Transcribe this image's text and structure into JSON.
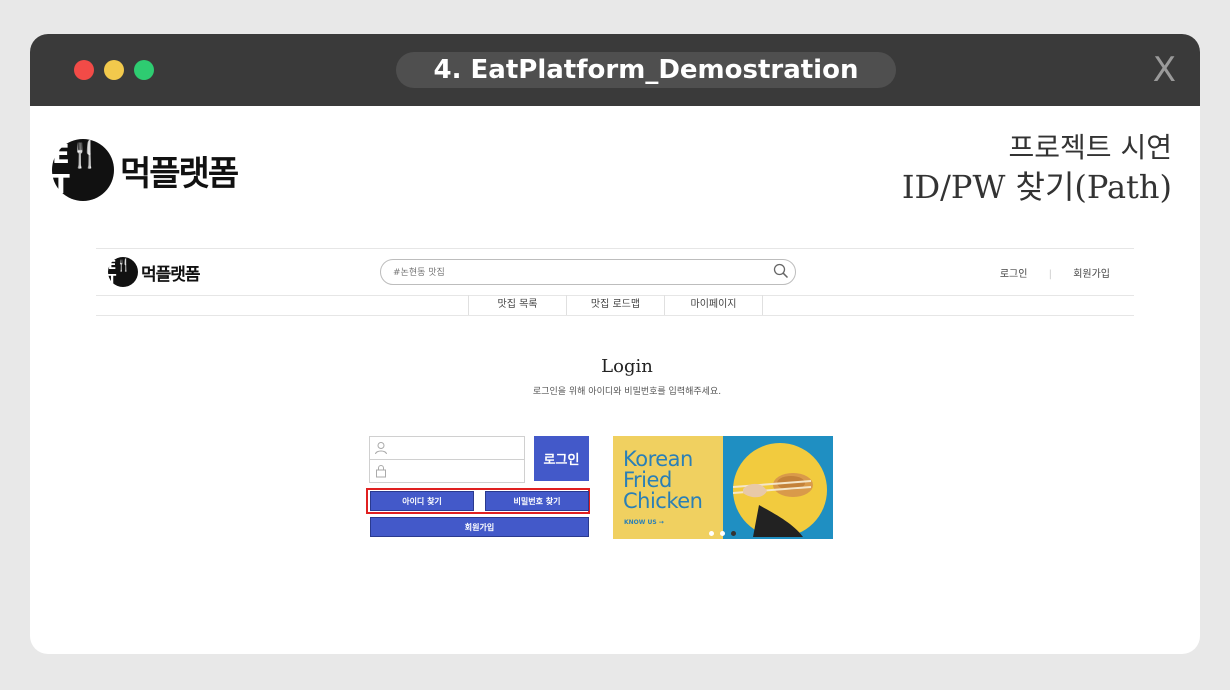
{
  "window": {
    "title": "4. EatPlatform_Demostration",
    "close_label": "X",
    "traffic_lights": [
      "#f24b47",
      "#f2c94c",
      "#2ecc71"
    ]
  },
  "slide": {
    "logo_badge": "E🍴T",
    "logo_text": "먹플랫폼",
    "subtitle": "프로젝트 시연",
    "title": "ID/PW 찾기(Path)"
  },
  "site": {
    "logo_badge": "E🍴T",
    "logo_text": "먹플랫폼",
    "search_placeholder": "#논현동 맛집",
    "top_links": [
      "로그인",
      "회원가입"
    ],
    "menu": [
      "맛집 목록",
      "맛집 로드맵",
      "마이페이지"
    ],
    "login": {
      "heading": "Login",
      "description": "로그인을 위해 아이디와 비밀번호를 입력해주세요.",
      "submit_label": "로그인",
      "find_id_label": "아이디 찾기",
      "find_pw_label": "비밀번호 찾기",
      "join_label": "회원가입"
    },
    "banner": {
      "line1": "Korean",
      "line2": "Fried",
      "line3": "Chicken",
      "cta": "KNOW US",
      "active_slide": 3,
      "slide_count": 3
    },
    "accent_color": "#4359c9",
    "highlight_color": "#e02020"
  }
}
